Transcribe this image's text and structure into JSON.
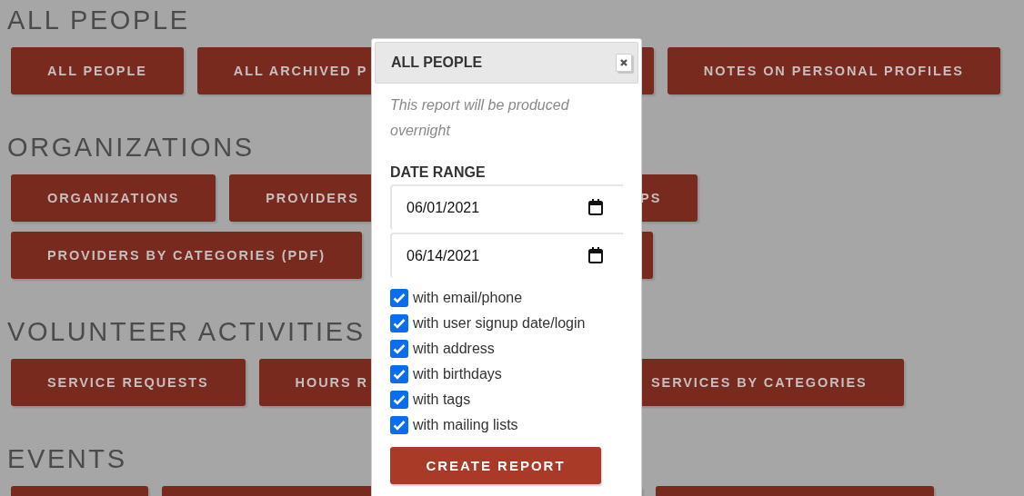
{
  "sections": [
    {
      "heading": "ALL PEOPLE",
      "rows": [
        [
          {
            "label": "ALL PEOPLE"
          },
          {
            "label": "ALL ARCHIVED P"
          },
          {
            "label": "NOTES ON PERSONAL PROFILES"
          }
        ]
      ]
    },
    {
      "heading": "ORGANIZATIONS",
      "rows": [
        [
          {
            "label": "ORGANIZATIONS"
          },
          {
            "label": "PROVIDERS"
          },
          {
            "label": "PS"
          }
        ],
        [
          {
            "label": "PROVIDERS BY CATEGORIES (PDF)"
          },
          {}
        ]
      ]
    },
    {
      "heading": "VOLUNTEER ACTIVITIES",
      "rows": [
        [
          {
            "label": "SERVICE REQUESTS"
          },
          {
            "label": "HOURS R"
          },
          {
            "label": "SERVICES BY CATEGORIES"
          }
        ]
      ]
    },
    {
      "heading": "EVENTS",
      "rows": [
        [
          {},
          {},
          {}
        ]
      ]
    }
  ],
  "dialog": {
    "title": "ALL PEOPLE",
    "note": "This report will be produced overnight",
    "date_range": {
      "label": "DATE RANGE",
      "from": "06/01/2021",
      "to": "06/14/2021"
    },
    "options": [
      {
        "label": "with email/phone",
        "checked": true
      },
      {
        "label": "with user signup date/login",
        "checked": true
      },
      {
        "label": "with address",
        "checked": true
      },
      {
        "label": "with birthdays",
        "checked": true
      },
      {
        "label": "with tags",
        "checked": true
      },
      {
        "label": "with mailing lists",
        "checked": true
      }
    ],
    "submit": "CREATE REPORT"
  }
}
